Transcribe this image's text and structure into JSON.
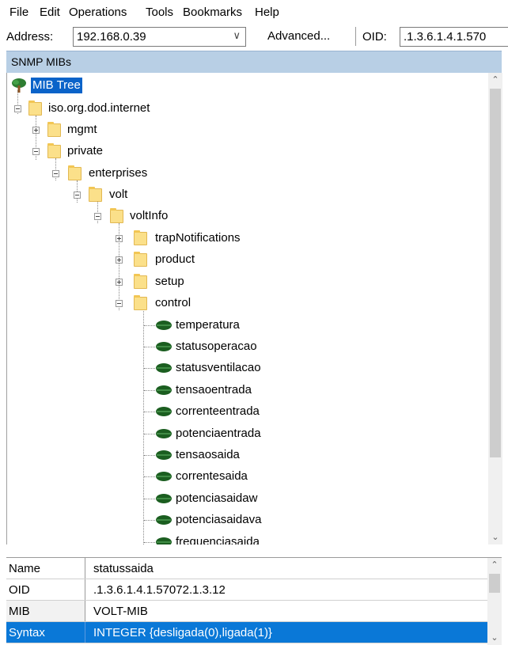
{
  "menu": [
    "File",
    "Edit",
    "Operations",
    "Tools",
    "Bookmarks",
    "Help"
  ],
  "toolbar": {
    "address_label": "Address:",
    "address_value": "192.168.0.39",
    "advanced_label": "Advanced...",
    "oid_label": "OID:",
    "oid_value": ".1.3.6.1.4.1.570"
  },
  "panel_title": "SNMP MIBs",
  "tree": {
    "root": "MIB Tree",
    "iso": "iso.org.dod.internet",
    "mgmt": "mgmt",
    "private": "private",
    "enterprises": "enterprises",
    "volt": "volt",
    "voltinfo": "voltInfo",
    "trap": "trapNotifications",
    "product": "product",
    "setup": "setup",
    "control": "control",
    "leaves": [
      "temperatura",
      "statusoperacao",
      "statusventilacao",
      "tensaoentrada",
      "correnteentrada",
      "potenciaentrada",
      "tensaosaida",
      "correntesaida",
      "potenciasaidaw",
      "potenciasaidava",
      "frequenciasaida"
    ]
  },
  "properties": [
    {
      "name": "Name",
      "value": "statussaida"
    },
    {
      "name": "OID",
      "value": ".1.3.6.1.4.1.57072.1.3.12"
    },
    {
      "name": "MIB",
      "value": "VOLT-MIB"
    },
    {
      "name": "Syntax",
      "value": "INTEGER {desligada(0),ligada(1)}"
    }
  ],
  "colors": {
    "selection": "#0a63c9",
    "panel_title_bg": "#b8cfe5",
    "folder": "#fbe08a",
    "leaf": "#1b5e20"
  }
}
